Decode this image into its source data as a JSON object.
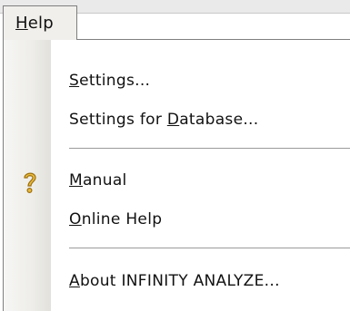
{
  "menu": {
    "title": "Help",
    "title_mnemonic": "H",
    "title_rest": "elp",
    "items": [
      {
        "label": "Settings...",
        "mnemonic": "S",
        "before": "",
        "after": "ettings..."
      },
      {
        "label": "Settings for Database...",
        "mnemonic": "D",
        "before": "Settings for ",
        "after": "atabase..."
      },
      {
        "label": "Manual",
        "mnemonic": "M",
        "before": "",
        "after": "anual",
        "icon": "help-question-icon"
      },
      {
        "label": "Online Help",
        "mnemonic": "O",
        "before": "",
        "after": "nline Help"
      },
      {
        "label": "About INFINITY ANALYZE...",
        "mnemonic": "A",
        "before": "",
        "after": "bout INFINITY ANALYZE..."
      }
    ]
  },
  "colors": {
    "menu_border": "#7f7f7f",
    "icon_strip": "#eeede9",
    "icon_gold": "#d9a521"
  }
}
